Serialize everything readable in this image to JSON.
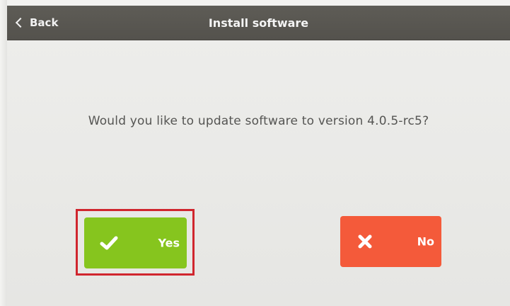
{
  "header": {
    "back_label": "Back",
    "title": "Install software",
    "background": "#57554f"
  },
  "dialog": {
    "question": "Would you like to update software to version 4.0.5-rc5?"
  },
  "buttons": {
    "yes": {
      "label": "Yes",
      "icon": "checkmark-icon",
      "color": "#86c51e"
    },
    "no": {
      "label": "No",
      "icon": "x-icon",
      "color": "#f45a3a"
    }
  },
  "highlight": {
    "target": "yes",
    "color": "#d0262e"
  }
}
